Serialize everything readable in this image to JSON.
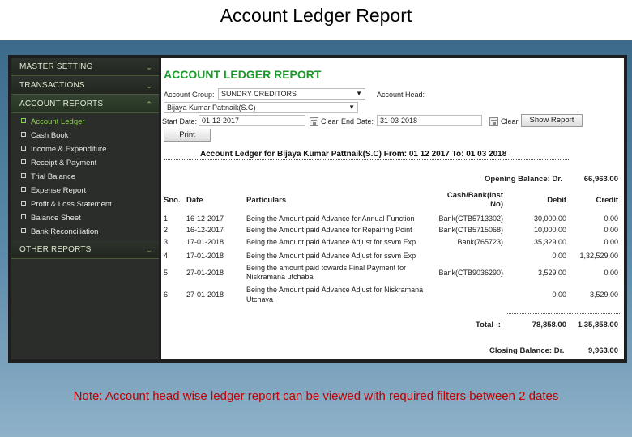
{
  "slide_title": "Account Ledger Report",
  "note": "Note: Account head wise ledger report can be viewed with required filters between 2 dates",
  "sidebar": {
    "sections": [
      {
        "label": "MASTER SETTING",
        "chevron": "⌄"
      },
      {
        "label": "TRANSACTIONS",
        "chevron": "⌄"
      },
      {
        "label": "ACCOUNT REPORTS",
        "chevron": "⌃"
      },
      {
        "label": "OTHER REPORTS",
        "chevron": "⌄"
      }
    ],
    "items": [
      {
        "label": "Account Ledger"
      },
      {
        "label": "Cash Book"
      },
      {
        "label": "Income & Expenditure"
      },
      {
        "label": "Receipt & Payment"
      },
      {
        "label": "Trial Balance"
      },
      {
        "label": "Expense Report"
      },
      {
        "label": "Profit & Loss Statement"
      },
      {
        "label": "Balance Sheet"
      },
      {
        "label": "Bank Reconciliation"
      }
    ]
  },
  "report": {
    "title": "ACCOUNT LEDGER REPORT",
    "account_group_label": "Account Group:",
    "account_group_value": "SUNDRY CREDITORS",
    "account_head_label": "Account Head:",
    "account_head_value": "Bijaya Kumar Pattnaik(S.C)",
    "start_date_label": "Start Date:",
    "start_date_value": "01-12-2017",
    "clear1_label": "Clear",
    "end_date_label": "End Date:",
    "end_date_value": "31-03-2018",
    "clear2_label": "Clear",
    "show_report_label": "Show Report",
    "print_label": "Print",
    "ledger_heading": "Account Ledger for Bijaya Kumar Pattnaik(S.C) From:  01 12 2017   To:  01 03 2018",
    "opening_balance_label": "Opening Balance: Dr.",
    "opening_balance_value": "66,963.00",
    "columns": [
      "Sno.",
      "Date",
      "Particulars",
      "Cash/Bank(Inst",
      "No)",
      "Debit",
      "Credit"
    ],
    "rows": [
      {
        "sno": "1",
        "date": "16-12-2017",
        "particulars": [
          "Being the Amount paid Advance for Annual Function"
        ],
        "bank": "Bank(CTB5713302)",
        "debit": "30,000.00",
        "credit": "0.00"
      },
      {
        "sno": "2",
        "date": "16-12-2017",
        "particulars": [
          "Being the Amount paid Advance for Repairing Point"
        ],
        "bank": "Bank(CTB5715068)",
        "debit": "10,000.00",
        "credit": "0.00"
      },
      {
        "sno": "3",
        "date": "17-01-2018",
        "particulars": [
          "Being the Amount paid Advance Adjust for ssvm Exp"
        ],
        "bank": "Bank(765723)",
        "debit": "35,329.00",
        "credit": "0.00"
      },
      {
        "sno": "4",
        "date": "17-01-2018",
        "particulars": [
          "Being the Amount paid Advance Adjust for ssvm Exp"
        ],
        "bank": "",
        "debit": "0.00",
        "credit": "1,32,529.00"
      },
      {
        "sno": "5",
        "date": "27-01-2018",
        "particulars": [
          "Being the amount paid towards Final Payment for",
          "Niskramana utchaba"
        ],
        "bank": "Bank(CTB9036290)",
        "debit": "3,529.00",
        "credit": "0.00"
      },
      {
        "sno": "6",
        "date": "27-01-2018",
        "particulars": [
          "Being the Amount paid Advance Adjust for Niskramana",
          "Utchava"
        ],
        "bank": "",
        "debit": "0.00",
        "credit": "3,529.00"
      }
    ],
    "total_label": "Total -:",
    "total_debit": "78,858.00",
    "total_credit": "1,35,858.00",
    "closing_balance_label": "Closing Balance: Dr.",
    "closing_balance_value": "9,963.00"
  },
  "colors": {
    "accent_green": "#1b9a2c",
    "sidebar_active": "#8fd14f",
    "note_red": "#c00000",
    "background_blue": "#3b6a8a"
  }
}
